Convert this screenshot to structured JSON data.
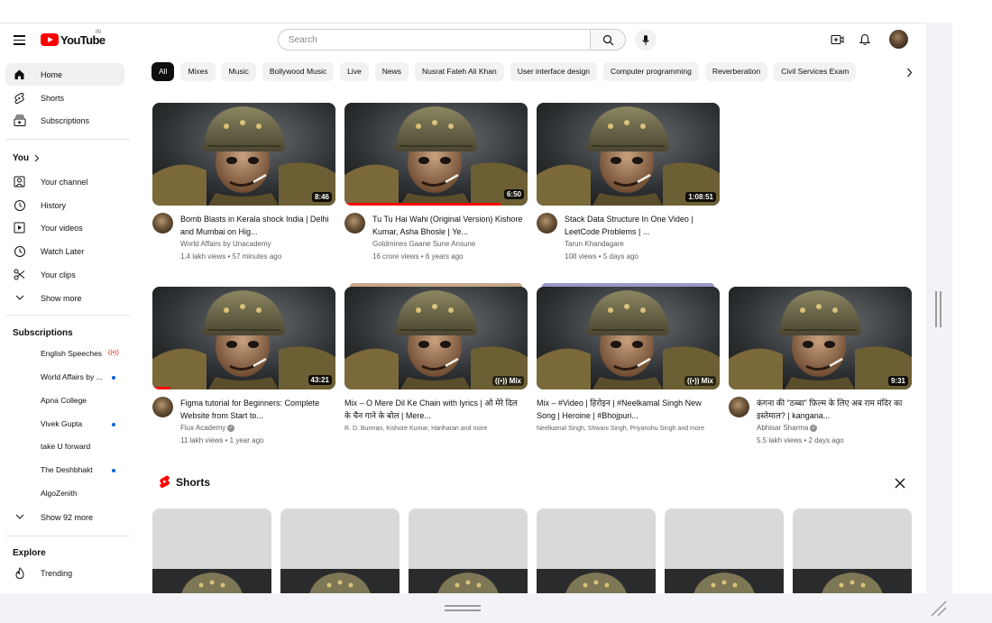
{
  "masthead": {
    "logo_text": "YouTube",
    "country_code": "IN",
    "search_placeholder": "Search"
  },
  "sidebar": {
    "main": [
      {
        "label": "Home",
        "icon": "home-icon",
        "active": true
      },
      {
        "label": "Shorts",
        "icon": "shorts-icon"
      },
      {
        "label": "Subscriptions",
        "icon": "subscriptions-icon"
      }
    ],
    "you_heading": "You",
    "you_items": [
      {
        "label": "Your channel",
        "icon": "channel-icon"
      },
      {
        "label": "History",
        "icon": "history-icon"
      },
      {
        "label": "Your videos",
        "icon": "your-videos-icon"
      },
      {
        "label": "Watch Later",
        "icon": "watch-later-icon"
      },
      {
        "label": "Your clips",
        "icon": "scissors-icon"
      },
      {
        "label": "Show more",
        "icon": "chevron-down-icon"
      }
    ],
    "subscriptions_heading": "Subscriptions",
    "subscriptions": [
      {
        "label": "English Speeches",
        "badge": "live"
      },
      {
        "label": "World Affairs by ...",
        "badge": "dot"
      },
      {
        "label": "Apna College",
        "badge": ""
      },
      {
        "label": "Vivek Gupta",
        "badge": "dot"
      },
      {
        "label": "take U forward",
        "badge": ""
      },
      {
        "label": "The Deshbhakt",
        "badge": "dot"
      },
      {
        "label": "AlgoZenith",
        "badge": ""
      }
    ],
    "show_more_subs": "Show 92 more",
    "explore_heading": "Explore",
    "explore_items": [
      {
        "label": "Trending",
        "icon": "trending-icon"
      }
    ]
  },
  "chips": [
    "All",
    "Mixes",
    "Music",
    "Bollywood Music",
    "Live",
    "News",
    "Nusrat Fateh Ali Khan",
    "User interface design",
    "Computer programming",
    "Reverberation",
    "Civil Services Exam"
  ],
  "videos_row1": [
    {
      "title": "Bomb Blasts in Kerala shock India | Delhi and Mumbai on Hig...",
      "channel": "World Affairs by Unacademy",
      "meta": "1.4 lakh views • 57 minutes ago",
      "duration": "8:46",
      "progress": 0
    },
    {
      "title": "Tu Tu Hai Wahi (Original Version) Kishore Kumar, Asha Bhosle | Ye...",
      "channel": "Goldmines Gaane Sune Ansune",
      "meta": "16 crore views • 6 years ago",
      "duration": "6:50",
      "progress": 0.85
    },
    {
      "title": "Stack Data Structure In One Video | LeetCode Problems | ...",
      "channel": "Tarun Khandagare",
      "meta": "108 views • 5 days ago",
      "duration": "1:08:51",
      "progress": 0
    }
  ],
  "videos_row2": [
    {
      "title": "Figma tutorial for Beginners: Complete Website from Start to...",
      "channel": "Flux Academy",
      "verified": true,
      "meta": "11 lakh views • 1 year ago",
      "duration": "43:21",
      "progress": 0.1
    },
    {
      "title": "Mix – O Mere Dil Ke Chain with lyrics | ओ मेरे दिल के चैन गाने के बोल | Mere...",
      "subtitle": "R. D. Burman, Kishore Kumar, Hariharan and more",
      "mix": true,
      "mix_label": "Mix",
      "stack_color": "#c9a88a"
    },
    {
      "title": "Mix – #Video | हिरोइन | #Neelkamal Singh New Song | Heroine | #Bhojpuri...",
      "subtitle": "Neelkamal Singh, Shivani Singh, Priyanshu Singh and more",
      "mix": true,
      "mix_label": "Mix",
      "stack_color": "#9a97c8"
    },
    {
      "title": "कंगना की \"ठब्बा\" फ़िल्म के लिए अब राम मंदिर का इस्तेमाल? | kangana...",
      "channel": "Abhisar Sharma",
      "verified": true,
      "meta": "5.5 lakh views • 2 days ago",
      "duration": "9:31",
      "progress": 0
    }
  ],
  "shorts": {
    "title": "Shorts",
    "count": 6
  },
  "colors": {
    "accent_red": "#ff0000",
    "chip_active_bg": "#0f0f0f",
    "subscription_dot": "#065fd4"
  }
}
